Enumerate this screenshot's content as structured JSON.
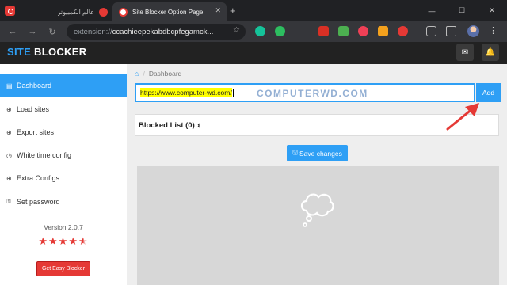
{
  "browser": {
    "tabs": [
      {
        "title": "عالم الكمبيوتر",
        "active": false,
        "icon": "red-favicon",
        "color": "#e53935"
      },
      {
        "title": "Site Blocker Option Page",
        "active": true,
        "icon": "block-favicon",
        "color": "#e53935"
      }
    ],
    "address": {
      "protocol": "extension://",
      "rest": "ccachieepekabdbcpfegamck..."
    },
    "window_controls": [
      "minimize-icon",
      "maximize-icon",
      "close-icon"
    ],
    "extensions": [
      {
        "name": "grammarly-icon",
        "color": "#15c39a"
      },
      {
        "name": "evernote-icon",
        "color": "#2dbe60"
      },
      {
        "name": "calendar-ext-icon",
        "color": "#d93025"
      },
      {
        "name": "sheet-ext-icon",
        "color": "#4caf50"
      },
      {
        "name": "pocket-ext-icon",
        "color": "#ef4056"
      },
      {
        "name": "rss-ext-icon",
        "color": "#f4a11d"
      },
      {
        "name": "block-ext-icon",
        "color": "#e53935"
      },
      {
        "name": "keyboard-ext-icon",
        "color": "#bdbdbd"
      },
      {
        "name": "extensions-puzzle-icon",
        "color": "#bdbdbd"
      }
    ]
  },
  "app": {
    "brand_part1": "SITE",
    "brand_part2": " BLOCKER",
    "header_buttons": [
      "mail-icon",
      "bell-icon"
    ]
  },
  "sidebar": {
    "items": [
      {
        "label": "Dashboard",
        "icon": "dashboard-icon",
        "glyph": "▤",
        "active": true
      },
      {
        "label": "Load sites",
        "icon": "upload-icon",
        "glyph": "⊕",
        "active": false
      },
      {
        "label": "Export sites",
        "icon": "download-icon",
        "glyph": "⊕",
        "active": false
      },
      {
        "label": "White time config",
        "icon": "clock-icon",
        "glyph": "◷",
        "active": false
      },
      {
        "label": "Extra Configs",
        "icon": "plus-circle-icon",
        "glyph": "⊕",
        "active": false
      },
      {
        "label": "Set password",
        "icon": "lock-icon",
        "glyph": "🔒",
        "active": false
      }
    ],
    "version": "Version 2.0.7",
    "rating": 4.5,
    "rating_max": 5,
    "get_button": "Get Easy Blocker"
  },
  "main": {
    "breadcrumb": "Dashboard",
    "url_value": "https://www.computer-wd.com/",
    "add_label": "Add",
    "watermark": "COMPUTERWD.COM",
    "blocked_title": "Blocked List (0)",
    "save_label": "Save changes"
  },
  "colors": {
    "accent": "#2e9ff5",
    "danger": "#e53935",
    "highlight": "#ffff00"
  }
}
